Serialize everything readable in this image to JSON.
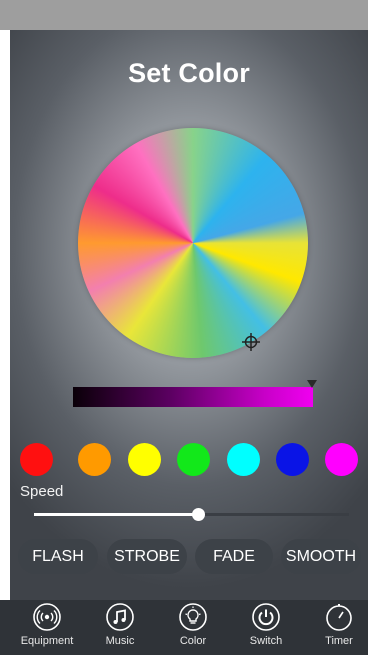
{
  "title": "Set Color",
  "swatches": [
    {
      "name": "red",
      "color": "#ff1010"
    },
    {
      "name": "orange",
      "color": "#ff9a00"
    },
    {
      "name": "yellow",
      "color": "#ffff00"
    },
    {
      "name": "green",
      "color": "#12e81a"
    },
    {
      "name": "cyan",
      "color": "#00ffff"
    },
    {
      "name": "blue",
      "color": "#0a14e6"
    },
    {
      "name": "magenta",
      "color": "#ff00ff"
    }
  ],
  "brightness_color": "#f000f0",
  "speed": {
    "label": "Speed",
    "value": 0.52
  },
  "modes": [
    "FLASH",
    "STROBE",
    "FADE",
    "SMOOTH"
  ],
  "tabs": [
    {
      "label": "Equipment",
      "icon": "broadcast-icon"
    },
    {
      "label": "Music",
      "icon": "music-note-icon"
    },
    {
      "label": "Color",
      "icon": "lightbulb-icon"
    },
    {
      "label": "Switch",
      "icon": "power-icon"
    },
    {
      "label": "Timer",
      "icon": "stopwatch-icon"
    }
  ]
}
